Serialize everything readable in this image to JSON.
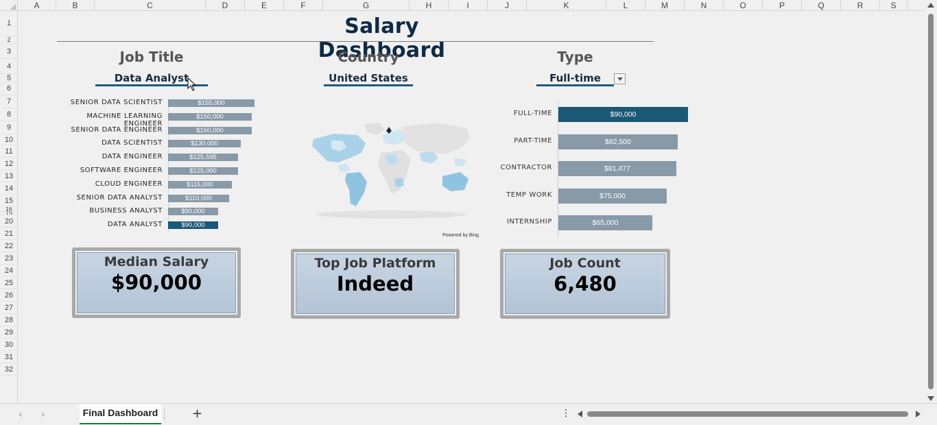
{
  "columns": [
    "A",
    "B",
    "C",
    "D",
    "E",
    "F",
    "G",
    "H",
    "I",
    "J",
    "K",
    "L",
    "M",
    "N",
    "O",
    "P",
    "Q",
    "R",
    "S"
  ],
  "rows": [
    "1",
    "2",
    "3",
    "4",
    "5",
    "6",
    "7",
    "8",
    "9",
    "10",
    "11",
    "12",
    "13",
    "14",
    "15",
    "16",
    "19",
    "20",
    "21",
    "22",
    "23",
    "24",
    "25",
    "26",
    "27",
    "28",
    "29",
    "30",
    "31",
    "32"
  ],
  "dashboard": {
    "title": "Salary Dashboard",
    "filters": {
      "job_title": {
        "heading": "Job Title",
        "value": "Data Analyst"
      },
      "country": {
        "heading": "Country",
        "value": "United States"
      },
      "type": {
        "heading": "Type",
        "value": "Full-time"
      }
    },
    "map_credit": "Powered by Bing",
    "kpis": {
      "median_salary": {
        "title": "Median Salary",
        "value": "$90,000"
      },
      "top_platform": {
        "title": "Top Job Platform",
        "value": "Indeed"
      },
      "job_count": {
        "title": "Job Count",
        "value": "6,480"
      }
    }
  },
  "chart_data": [
    {
      "type": "bar",
      "orientation": "horizontal",
      "categories": [
        "SENIOR DATA SCIENTIST",
        "MACHINE LEARNING ENGINEER",
        "SENIOR DATA ENGINEER",
        "DATA SCIENTIST",
        "DATA ENGINEER",
        "SOFTWARE ENGINEER",
        "CLOUD ENGINEER",
        "SENIOR DATA ANALYST",
        "BUSINESS ANALYST",
        "DATA ANALYST"
      ],
      "values": [
        155000,
        150000,
        150000,
        130000,
        125595,
        125000,
        115000,
        110000,
        90000,
        90000
      ],
      "labels": [
        "$155,000",
        "$150,000",
        "$150,000",
        "$130,000",
        "$125,595",
        "$125,000",
        "$115,000",
        "$110,000",
        "$90,000",
        "$90,000"
      ],
      "highlighted": "DATA ANALYST",
      "colors": {
        "bar": "#8899a8",
        "highlight": "#1b5876"
      }
    },
    {
      "type": "bar",
      "orientation": "horizontal",
      "categories": [
        "FULL-TIME",
        "PART-TIME",
        "CONTRACTOR",
        "TEMP WORK",
        "INTERNSHIP"
      ],
      "values": [
        90000,
        82500,
        81477,
        75000,
        65000
      ],
      "labels": [
        "$90,000",
        "$82,500",
        "$81,477",
        "$75,000",
        "$65,000"
      ],
      "highlighted": "FULL-TIME",
      "colors": {
        "bar": "#8899a8",
        "highlight": "#1b5876"
      }
    }
  ],
  "tabs": {
    "active": "Final Dashboard",
    "add_label": "+"
  },
  "icons": {
    "prev_sheet": "‹",
    "next_sheet": "›",
    "more": "⋮"
  },
  "colors": {
    "accent": "#1b5876",
    "title": "#0f2a44",
    "tab_underline": "#1b7a3c"
  }
}
